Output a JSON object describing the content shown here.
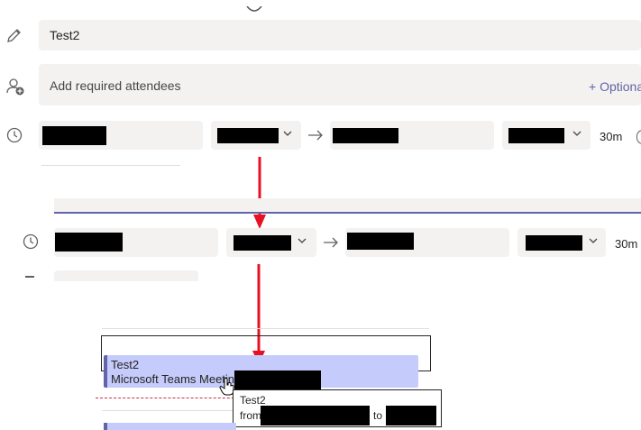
{
  "title_field": {
    "value": "Test2"
  },
  "attendees": {
    "placeholder": "Add required attendees",
    "optional_label": "+ Optional"
  },
  "time_row_1": {
    "duration": "30m"
  },
  "time_row_2": {
    "duration": "30m"
  },
  "calendar_event": {
    "title": "Test2",
    "subtitle": "Microsoft Teams Meeting"
  },
  "tooltip": {
    "title": "Test2",
    "from_label": "from",
    "to_label": "to"
  },
  "colors": {
    "accent": "#6264a7",
    "event_bg": "#c5cbfa",
    "arrow": "#e81123",
    "now_line": "#c4314b"
  },
  "icons": [
    "pencil-icon",
    "add-person-icon",
    "clock-icon",
    "arrow-right-icon",
    "chevron-down-icon",
    "hand-cursor-icon"
  ]
}
